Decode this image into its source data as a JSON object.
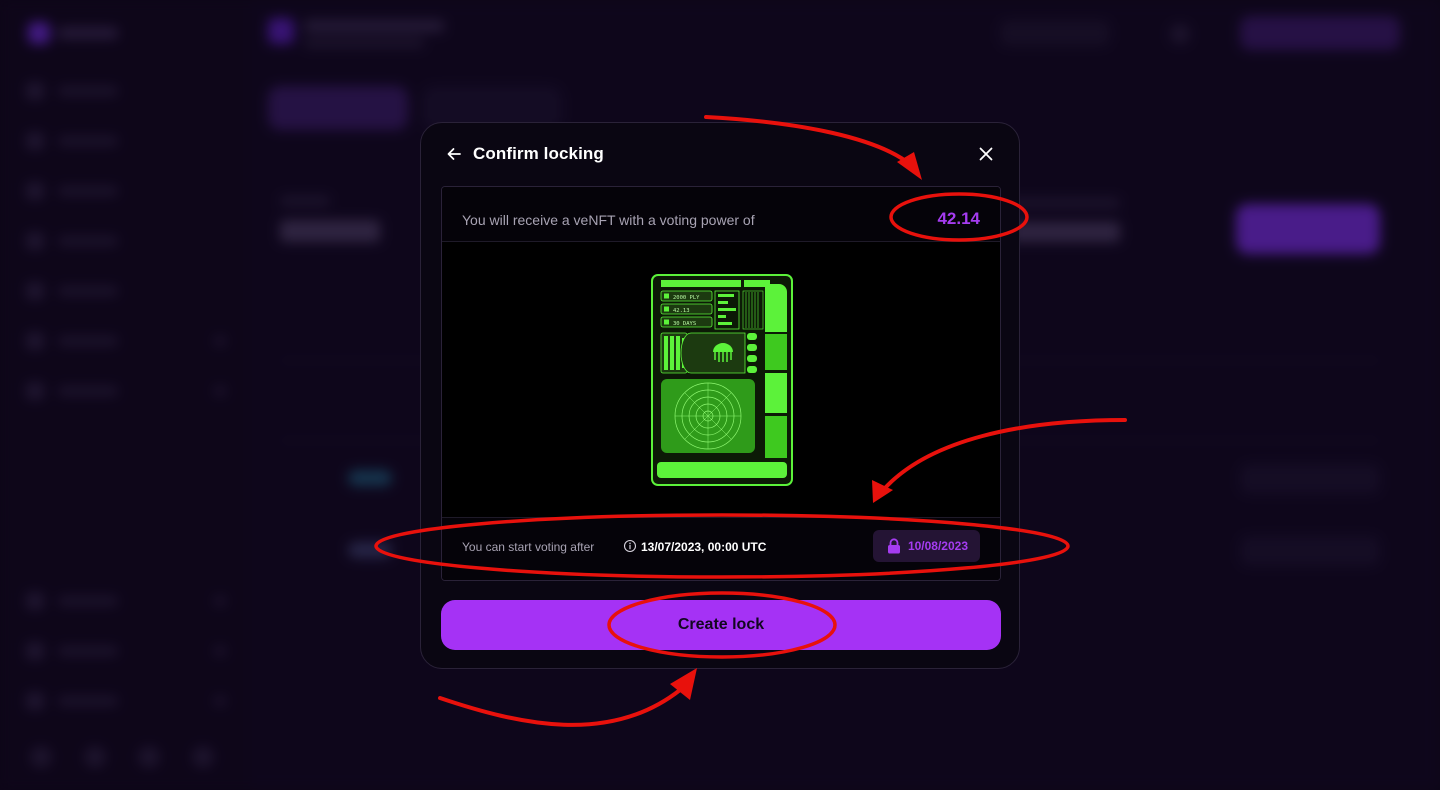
{
  "modal": {
    "title": "Confirm locking",
    "back_icon": "arrow-left-icon",
    "close_icon": "close-icon",
    "receive_text": "You will receive a veNFT with a voting power of",
    "voting_power": "42.14",
    "nft_preview": {
      "locked_amount": "2000 PLY",
      "power": "42.13",
      "duration": "30 DAYS",
      "accent_color": "#5cf23a"
    },
    "voting_start_label": "You can start voting after",
    "voting_start_date": "13/07/2023, 00:00 UTC",
    "lock_expiry": "10/08/2023",
    "lock_icon": "lock-icon",
    "info_icon": "info-icon",
    "create_button_label": "Create lock"
  },
  "colors": {
    "accent": "#a532f5",
    "power_text": "#a53cf0",
    "annotation": "#e8110c",
    "nft_green": "#5cf23a"
  }
}
